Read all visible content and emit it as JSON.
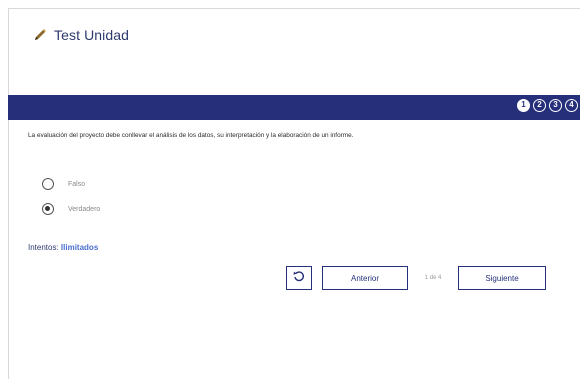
{
  "header": {
    "title": "Test Unidad",
    "icon": "pencil-icon"
  },
  "progress": {
    "steps": [
      "1",
      "2",
      "3",
      "4"
    ],
    "current": 1
  },
  "question": {
    "text": "La evaluación del proyecto debe conllevar el análisis de los datos, su interpretación y la elaboración de un informe."
  },
  "options": [
    {
      "label": "Falso",
      "selected": false
    },
    {
      "label": "Verdadero",
      "selected": true
    }
  ],
  "attempts": {
    "label": "Intentos:",
    "value": "Ilimitados"
  },
  "navigation": {
    "reset_icon": "reset-icon",
    "prev_label": "Anterior",
    "counter": "1 de 4",
    "next_label": "Siguiente"
  },
  "colors": {
    "accent": "#26307a",
    "link": "#4a6fd0"
  }
}
